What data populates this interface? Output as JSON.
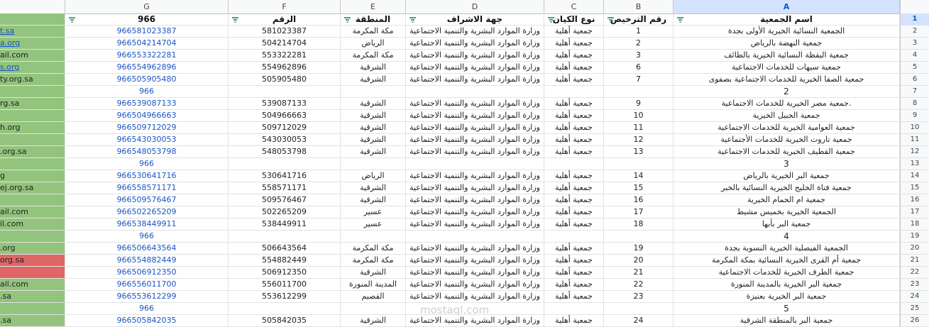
{
  "columns": [
    "G",
    "F",
    "E",
    "D",
    "C",
    "B",
    "A"
  ],
  "header_row": {
    "G": "966",
    "F": "الرقم",
    "E": "المنطقة",
    "D": "جهة الاشراف",
    "C": "نوع الكيان",
    "B": "رقم الترخيص",
    "A": "اسم الجمعية"
  },
  "rows": [
    {
      "n": "2",
      "h": "t.sa",
      "hlink": true,
      "g": "966581023387",
      "f": "581023387",
      "e": "مكة المكرمة",
      "d": "وزارة الموارد البشرية والتنمية الاجتماعية",
      "c": "جمعية أهلية",
      "b": "1",
      "a": "الجمعية النسائية الخيرية الأولى بجدة"
    },
    {
      "n": "3",
      "h": "a.org",
      "hlink": true,
      "g": "966504214704",
      "f": "504214704",
      "e": "الرياض",
      "d": "وزارة الموارد البشرية والتنمية الاجتماعية",
      "c": "جمعية أهلية",
      "b": "2",
      "a": "جمعية النهضة بالرياض"
    },
    {
      "n": "4",
      "h": "ail.com",
      "g": "966553322281",
      "f": "553322281",
      "e": "مكة المكرمة",
      "d": "وزارة الموارد البشرية والتنمية الاجتماعية",
      "c": "جمعية أهلية",
      "b": "3",
      "a": "جمعية اليقظة النسائية الخيرية بالطائف"
    },
    {
      "n": "5",
      "h": "s.org",
      "hlink": true,
      "g": "966554962896",
      "f": "554962896",
      "e": "الشرقية",
      "d": "وزارة الموارد البشرية والتنمية الاجتماعية",
      "c": "جمعية أهلية",
      "b": "6",
      "a": "جمعية سيهات للخدمات الاجتماعية"
    },
    {
      "n": "6",
      "h": "ty.org.sa",
      "g": "966505905480",
      "f": "505905480",
      "e": "الشرقية",
      "d": "وزارة الموارد البشرية والتنمية الاجتماعية",
      "c": "جمعية أهلية",
      "b": "7",
      "a": "جمعية الصفا الخيرية للخدمات الاجتماعية بصفوى"
    },
    {
      "n": "7",
      "sep": true,
      "g": "966",
      "a": "2"
    },
    {
      "n": "8",
      "h": "rg.sa",
      "g": "966539087133",
      "f": "539087133",
      "e": "الشرقية",
      "d": "وزارة الموارد البشرية والتنمية الاجتماعية",
      "c": "جمعية أهلية",
      "b": "9",
      "a": "جمعية مضر الخيرية للخدمات الاجتماعية."
    },
    {
      "n": "9",
      "h": "",
      "g": "966504966663",
      "f": "504966663",
      "e": "الشرقية",
      "d": "وزارة الموارد البشرية والتنمية الاجتماعية",
      "c": "جمعية أهلية",
      "b": "10",
      "a": "جمعية الجبيل الخيرية"
    },
    {
      "n": "10",
      "h": "h.org",
      "g": "966509712029",
      "f": "509712029",
      "e": "الشرقية",
      "d": "وزارة الموارد البشرية والتنمية الاجتماعية",
      "c": "جمعية أهلية",
      "b": "11",
      "a": "جمعية العوامية الخيرية للخدمات الاجتماعية"
    },
    {
      "n": "11",
      "h": "",
      "g": "966543030053",
      "f": "543030053",
      "e": "الشرقية",
      "d": "وزارة الموارد البشرية والتنمية الاجتماعية",
      "c": "جمعية أهلية",
      "b": "12",
      "a": "جمعية تاروت الخيرية للخدمات الأجتماعية"
    },
    {
      "n": "12",
      "h": ".org.sa",
      "g": "966548053798",
      "f": "548053798",
      "e": "الشرقية",
      "d": "وزارة الموارد البشرية والتنمية الاجتماعية",
      "c": "جمعية أهلية",
      "b": "13",
      "a": "جمعية القطيف الخيرية للخدمات الاجتماعية"
    },
    {
      "n": "13",
      "sep": true,
      "g": "966",
      "a": "3"
    },
    {
      "n": "14",
      "h": "g",
      "g": "966530641716",
      "f": "530641716",
      "e": "الرياض",
      "d": "وزارة الموارد البشرية والتنمية الاجتماعية",
      "c": "جمعية أهلية",
      "b": "14",
      "a": "جمعية البر الخيرية بالرياض"
    },
    {
      "n": "15",
      "h": "ej.org.sa",
      "g": "966558571171",
      "f": "558571171",
      "e": "الشرقية",
      "d": "وزارة الموارد البشرية والتنمية الاجتماعية",
      "c": "جمعية أهلية",
      "b": "15",
      "a": "جمعية فتاة الخليج الخيرية النسائية بالخبر"
    },
    {
      "n": "16",
      "h": "",
      "g": "966509576467",
      "f": "509576467",
      "e": "الشرقية",
      "d": "وزارة الموارد البشرية والتنمية الاجتماعية",
      "c": "جمعية أهلية",
      "b": "16",
      "a": "جمعية ام الحمام الخيرية"
    },
    {
      "n": "17",
      "h": "ail.com",
      "g": "966502265209",
      "f": "502265209",
      "e": "عسير",
      "d": "وزارة الموارد البشرية والتنمية الاجتماعية",
      "c": "جمعية أهلية",
      "b": "17",
      "a": "الجمعية الخيرية بخميس مشيط"
    },
    {
      "n": "18",
      "h": "il.com",
      "g": "966538449911",
      "f": "538449911",
      "e": "عسير",
      "d": "وزارة الموارد البشرية والتنمية الاجتماعية",
      "c": "جمعية أهلية",
      "b": "18",
      "a": "جمعية البر بأبها"
    },
    {
      "n": "19",
      "sep": true,
      "g": "966",
      "a": "4"
    },
    {
      "n": "20",
      "h": ".org",
      "g": "966506643564",
      "f": "506643564",
      "e": "مكة المكرمة",
      "d": "وزارة الموارد البشرية والتنمية الاجتماعية",
      "c": "جمعية أهلية",
      "b": "19",
      "a": "الجمعية الفيصلية الخيرية النسوية بجدة"
    },
    {
      "n": "21",
      "h": "org.sa",
      "red": true,
      "g": "966554882449",
      "f": "554882449",
      "e": "مكة المكرمة",
      "d": "وزارة الموارد البشرية والتنمية الاجتماعية",
      "c": "جمعية أهلية",
      "b": "20",
      "a": "جمعية أم القرى الخيرية النسائية بمكة المكرمة"
    },
    {
      "n": "22",
      "h": "",
      "red": true,
      "g": "966506912350",
      "f": "506912350",
      "e": "الشرقية",
      "d": "وزارة الموارد البشرية والتنمية الاجتماعية",
      "c": "جمعية أهلية",
      "b": "21",
      "a": "جمعية الطرف الخيرية للخدمات الاجتماعية"
    },
    {
      "n": "23",
      "h": "ail.com",
      "g": "966556011700",
      "f": "556011700",
      "e": "المدينة المنورة",
      "d": "وزارة الموارد البشرية والتنمية الاجتماعية",
      "c": "جمعية أهلية",
      "b": "22",
      "a": "جمعية البر الخيرية بالمدينة المنورة"
    },
    {
      "n": "24",
      "h": ".sa",
      "g": "966553612299",
      "f": "553612299",
      "e": "القصيم",
      "d": "وزارة الموارد البشرية والتنمية الاجتماعية",
      "c": "جمعية أهلية",
      "b": "23",
      "a": "جمعية البر الخيرية بعنيزة"
    },
    {
      "n": "25",
      "sep": true,
      "g": "966",
      "a": "5"
    },
    {
      "n": "26",
      "h": ".sa",
      "g": "966505842035",
      "f": "505842035",
      "e": "الشرقية",
      "d": "وزارة الموارد البشرية والتنمية الاجتماعية",
      "c": "جمعية أهلية",
      "b": "24",
      "a": "جمعية البر بالمنطقة الشرقية"
    }
  ],
  "row1_label": "1",
  "watermark": "mostaql.com"
}
